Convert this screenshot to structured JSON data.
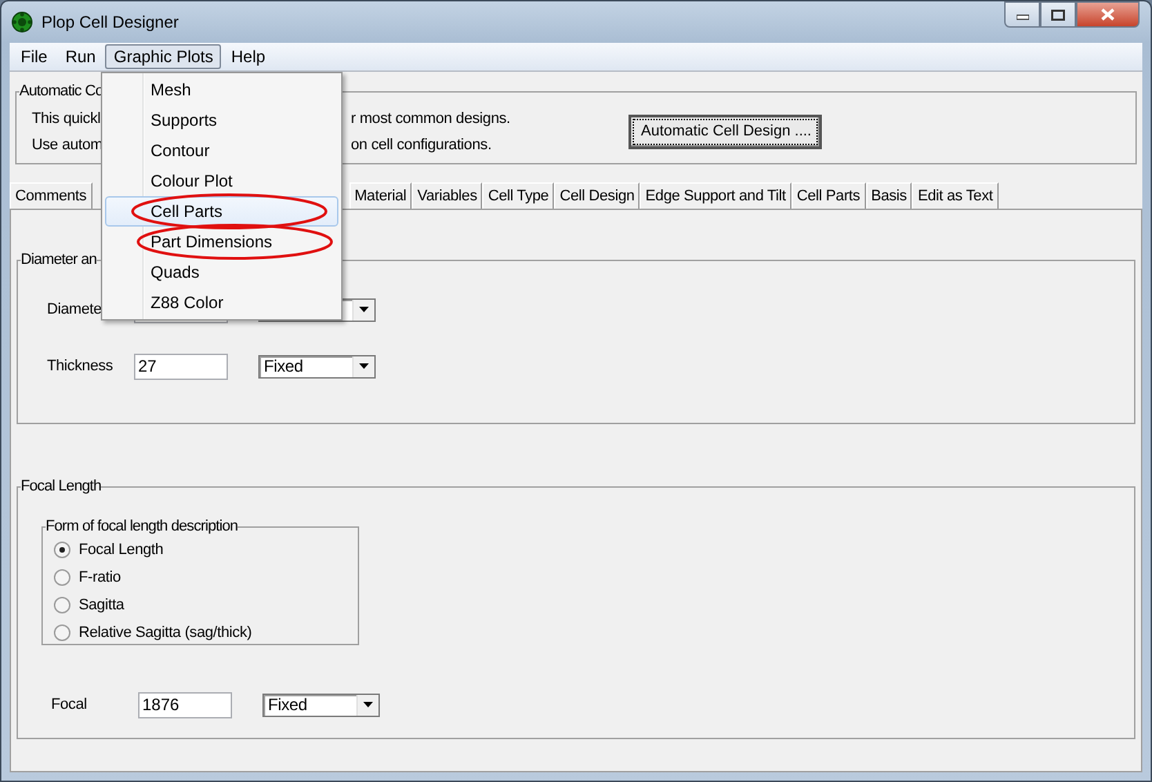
{
  "window": {
    "title": "Plop Cell Designer"
  },
  "menu_bar": [
    {
      "label": "File",
      "selected": false
    },
    {
      "label": "Run",
      "selected": false
    },
    {
      "label": "Graphic Plots",
      "selected": true
    },
    {
      "label": "Help",
      "selected": false
    }
  ],
  "graphic_plots_menu": [
    {
      "label": "Mesh",
      "selected": false,
      "circled": false
    },
    {
      "label": "Supports",
      "selected": false,
      "circled": false
    },
    {
      "label": "Contour",
      "selected": false,
      "circled": false
    },
    {
      "label": "Colour Plot",
      "selected": false,
      "circled": false
    },
    {
      "label": "Cell Parts",
      "selected": true,
      "circled": true
    },
    {
      "label": "Part Dimensions",
      "selected": false,
      "circled": true
    },
    {
      "label": "Quads",
      "selected": false,
      "circled": false
    },
    {
      "label": "Z88 Color",
      "selected": false,
      "circled": false
    }
  ],
  "automatic_group": {
    "title": "Automatic Co",
    "lines": [
      {
        "left": "This quickl",
        "right": "r most common designs."
      },
      {
        "left": "Use autom",
        "right": "on cell configurations."
      }
    ],
    "button": "Automatic Cell Design ...."
  },
  "tabs": {
    "left": [
      {
        "label": "Comments",
        "selected": false
      }
    ],
    "right": [
      {
        "label": "Material",
        "selected": false
      },
      {
        "label": "Variables",
        "selected": false
      },
      {
        "label": "Cell Type",
        "selected": false
      },
      {
        "label": "Cell Design",
        "selected": false
      },
      {
        "label": "Edge Support and Tilt",
        "selected": false
      },
      {
        "label": "Cell Parts",
        "selected": false
      },
      {
        "label": "Basis",
        "selected": false
      },
      {
        "label": "Edit as Text",
        "selected": false
      }
    ]
  },
  "diameter_group": {
    "title": "Diameter an",
    "rows": [
      {
        "label": "Diamete"
      },
      {
        "label": "Thickness",
        "value": "27",
        "mode": "Fixed"
      }
    ]
  },
  "focal_group": {
    "title": "Focal Length",
    "form": {
      "title": "Form of focal length description",
      "options": [
        {
          "label": "Focal Length",
          "selected": true
        },
        {
          "label": "F-ratio",
          "selected": false
        },
        {
          "label": "Sagitta",
          "selected": false
        },
        {
          "label": "Relative Sagitta (sag/thick)",
          "selected": false
        }
      ]
    },
    "rows": [
      {
        "label": "Focal",
        "value": "1876",
        "mode": "Fixed"
      }
    ]
  }
}
